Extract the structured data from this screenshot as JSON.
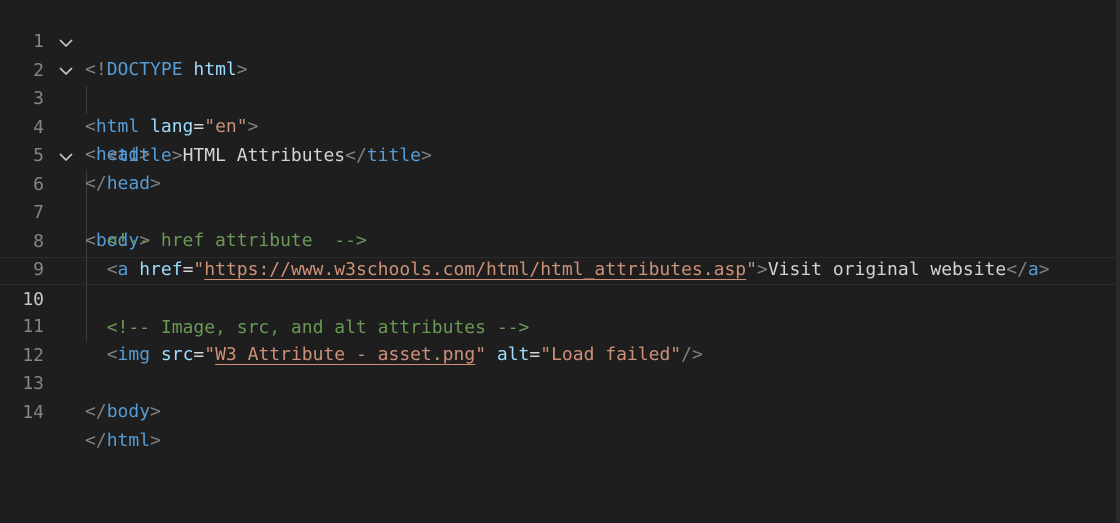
{
  "editor": {
    "line_numbers": [
      "1",
      "2",
      "3",
      "4",
      "5",
      "6",
      "7",
      "8",
      "9",
      "10",
      "11",
      "12",
      "13",
      "14"
    ],
    "current_line": "10",
    "folds": [
      "chevron-down-icon",
      "chevron-down-icon",
      "chevron-down-icon"
    ],
    "lines": {
      "l1": {
        "open": "<!",
        "doctype": "DOCTYPE",
        "space": " ",
        "html": "html",
        "close": ">"
      },
      "l2": {
        "open": "<",
        "tag": "html",
        "attr": "lang",
        "eq": "=",
        "val": "\"en\"",
        "close": ">"
      },
      "l3": {
        "open": "<",
        "tag": "head",
        "close": ">"
      },
      "l4": {
        "indent": "  ",
        "open": "<",
        "tag": "title",
        "close": ">",
        "text": "HTML Attributes",
        "end_open": "</",
        "end_tag": "title",
        "end_close": ">"
      },
      "l5": {
        "open": "</",
        "tag": "head",
        "close": ">"
      },
      "l6": {
        "open": "<",
        "tag": "body",
        "close": ">"
      },
      "l7": {
        "indent": "  ",
        "comment": "<!-- href attribute  -->"
      },
      "l8": {
        "indent": "  ",
        "open": "<",
        "tag": "a",
        "attr": "href",
        "eq": "=",
        "q1": "\"",
        "url": "https://www.w3schools.com/html/html_attributes.asp",
        "q2": "\"",
        "close": ">",
        "text": "Visit original website",
        "end_open": "</",
        "end_tag": "a",
        "end_close": ">"
      },
      "l10": {
        "indent": "  ",
        "comment": "<!-- Image, src, and alt attributes -->"
      },
      "l11": {
        "indent": "  ",
        "open": "<",
        "tag": "img",
        "attr1": "src",
        "eq1": "=",
        "q1": "\"",
        "src": "W3 Attribute - asset.png",
        "q2": "\"",
        "attr2": "alt",
        "eq2": "=",
        "alt": "\"Load failed\"",
        "close": "/>"
      },
      "l13": {
        "open": "</",
        "tag": "body",
        "close": ">"
      },
      "l14": {
        "open": "</",
        "tag": "html",
        "close": ">"
      }
    }
  }
}
